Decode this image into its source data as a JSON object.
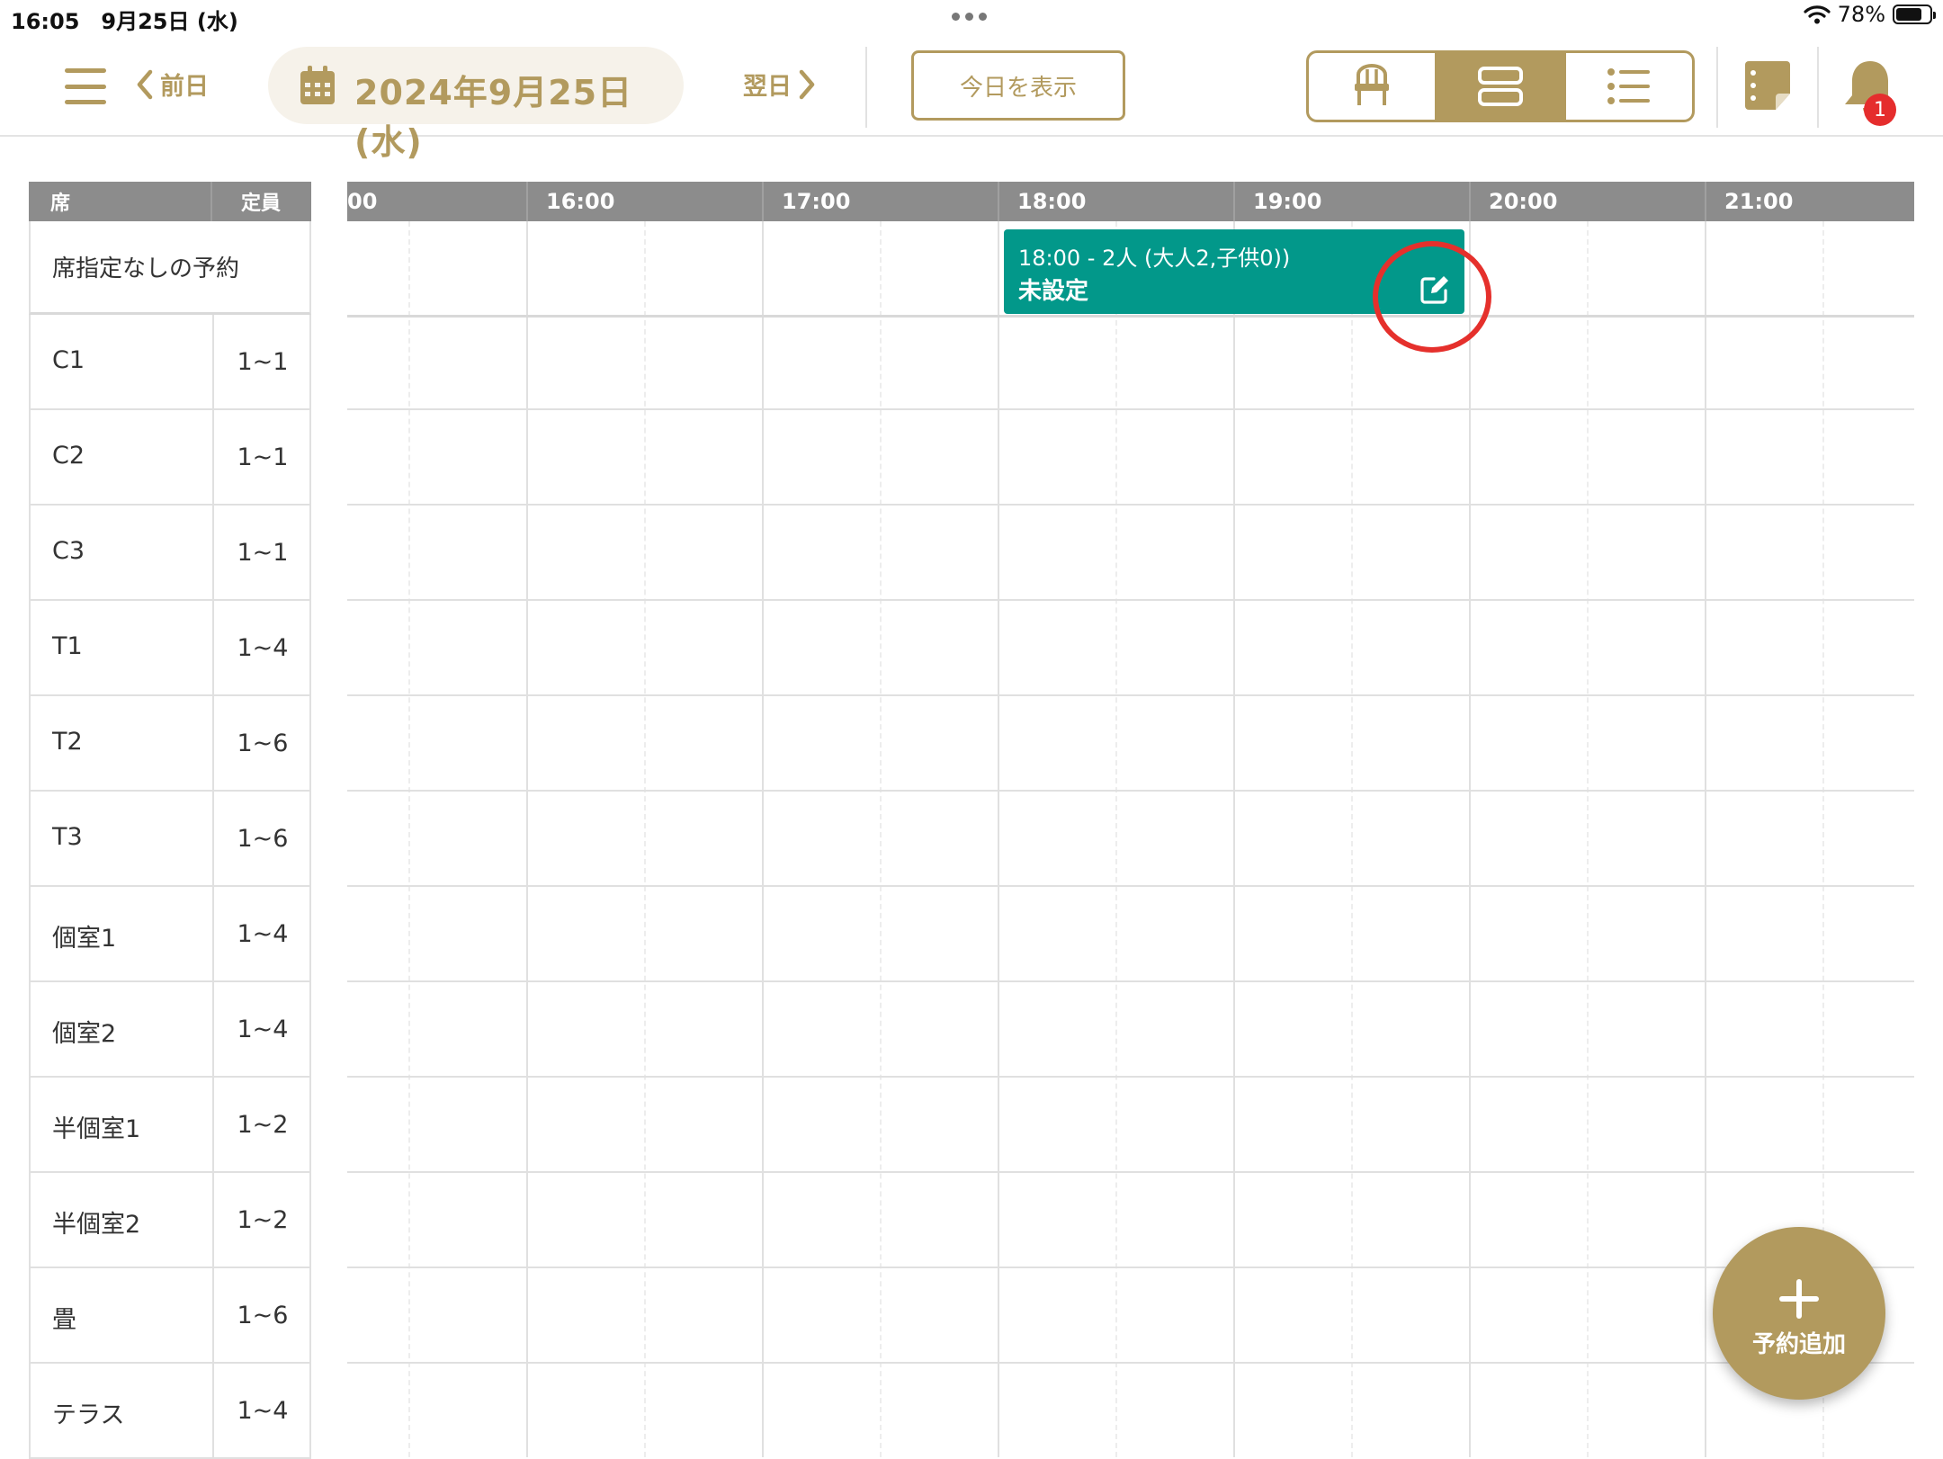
{
  "status_bar": {
    "time_date": "16:05　9月25日 (水)",
    "battery_pct": "78%",
    "battery_level": 0.78
  },
  "header": {
    "prev_label": "前日",
    "date_label": "2024年9月25日 (水)",
    "next_label": "翌日",
    "today_button": "今日を表示",
    "view_icons": [
      "chair-icon",
      "rows-icon",
      "list-icon"
    ],
    "active_view": 1,
    "notification_count": "1"
  },
  "seat_table": {
    "header_seat": "席",
    "header_capacity": "定員",
    "unassigned_label": "席指定なしの予約",
    "rows": [
      {
        "name": "C1",
        "capacity": "1~1"
      },
      {
        "name": "C2",
        "capacity": "1~1"
      },
      {
        "name": "C3",
        "capacity": "1~1"
      },
      {
        "name": "T1",
        "capacity": "1~4"
      },
      {
        "name": "T2",
        "capacity": "1~6"
      },
      {
        "name": "T3",
        "capacity": "1~6"
      },
      {
        "name": "個室1",
        "capacity": "1~4"
      },
      {
        "name": "個室2",
        "capacity": "1~4"
      },
      {
        "name": "半個室1",
        "capacity": "1~2"
      },
      {
        "name": "半個室2",
        "capacity": "1~2"
      },
      {
        "name": "畳",
        "capacity": "1~6"
      },
      {
        "name": "テラス",
        "capacity": "1~4"
      }
    ]
  },
  "timeline": {
    "partial_label": "00",
    "hours": [
      "16:00",
      "17:00",
      "18:00",
      "19:00",
      "20:00",
      "21:00"
    ]
  },
  "reservation": {
    "summary": "18:00 - 2人 (大人2,子供0))",
    "status": "未設定"
  },
  "fab": {
    "label": "予約追加"
  },
  "colors": {
    "accent": "#b29a5e",
    "reservation": "#02988a",
    "header_gray": "#8c8c8c",
    "highlight": "#e5302c"
  }
}
